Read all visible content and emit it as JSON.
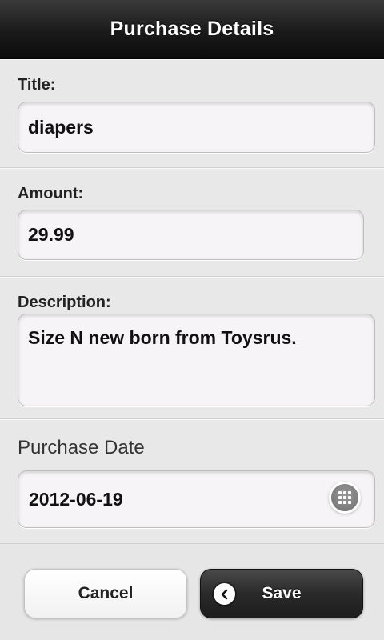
{
  "header": {
    "title": "Purchase Details"
  },
  "form": {
    "title": {
      "label": "Title:",
      "value": "diapers"
    },
    "amount": {
      "label": "Amount:",
      "value": "29.99"
    },
    "description": {
      "label": "Description:",
      "value": "Size N new born from Toysrus."
    },
    "purchase_date": {
      "label": "Purchase Date",
      "value": "2012-06-19",
      "icon": "calendar-grid-icon"
    }
  },
  "buttons": {
    "cancel_label": "Cancel",
    "save_label": "Save",
    "save_icon": "chevron-left-icon"
  },
  "colors": {
    "header_background": "#1a1a1a",
    "page_background": "#e8e8e8",
    "input_background": "#f7f4f7",
    "primary_button": "#2a2a2a"
  }
}
